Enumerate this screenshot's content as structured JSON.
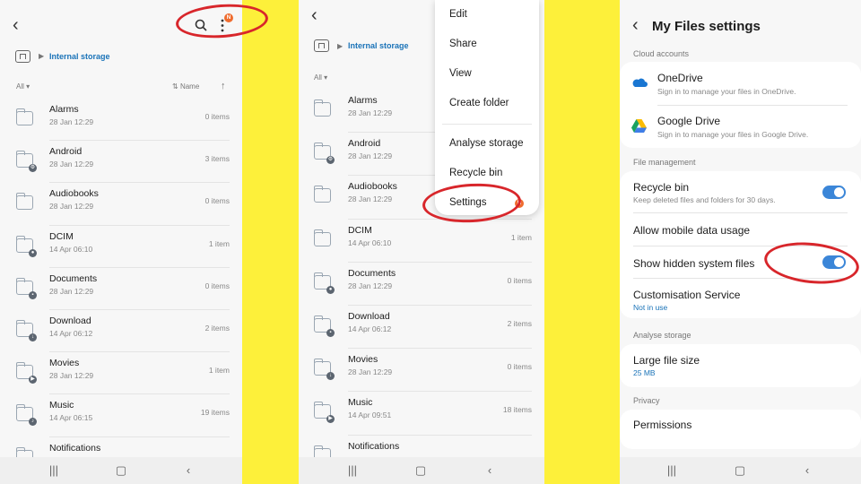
{
  "colors": {
    "accent": "#1a73b8",
    "annotation": "#d8262b",
    "background": "#fdf03a",
    "badge": "#ef6c2f",
    "toggle": "#3b86d8"
  },
  "panel1": {
    "breadcrumb": "Internal storage",
    "filter": "All",
    "sort": "Name",
    "notification_badge": "N",
    "files": [
      {
        "name": "Alarms",
        "date": "28 Jan 12:29",
        "count": "0 items",
        "badge": ""
      },
      {
        "name": "Android",
        "date": "28 Jan 12:29",
        "count": "3 items",
        "badge": "gear"
      },
      {
        "name": "Audiobooks",
        "date": "28 Jan 12:29",
        "count": "0 items",
        "badge": ""
      },
      {
        "name": "DCIM",
        "date": "14 Apr 06:10",
        "count": "1 item",
        "badge": "camera"
      },
      {
        "name": "Documents",
        "date": "28 Jan 12:29",
        "count": "0 items",
        "badge": "doc"
      },
      {
        "name": "Download",
        "date": "14 Apr 06:12",
        "count": "2 items",
        "badge": "download"
      },
      {
        "name": "Movies",
        "date": "28 Jan 12:29",
        "count": "1 item",
        "badge": "play"
      },
      {
        "name": "Music",
        "date": "14 Apr 06:15",
        "count": "19 items",
        "badge": "music"
      },
      {
        "name": "Notifications",
        "date": "",
        "count": "",
        "badge": ""
      }
    ]
  },
  "panel2": {
    "breadcrumb": "Internal storage",
    "filter": "All",
    "files": [
      {
        "name": "Alarms",
        "date": "28 Jan 12:29",
        "count": ""
      },
      {
        "name": "Android",
        "date": "28 Jan 12:29",
        "count": ""
      },
      {
        "name": "Audiobooks",
        "date": "28 Jan 12:29",
        "count": ""
      },
      {
        "name": "DCIM",
        "date": "14 Apr 06:10",
        "count": "1 item"
      },
      {
        "name": "Documents",
        "date": "28 Jan 12:29",
        "count": "0 items"
      },
      {
        "name": "Download",
        "date": "14 Apr 06:12",
        "count": "2 items"
      },
      {
        "name": "Movies",
        "date": "28 Jan 12:29",
        "count": "0 items"
      },
      {
        "name": "Music",
        "date": "14 Apr 09:51",
        "count": "18 items"
      },
      {
        "name": "Notifications",
        "date": "",
        "count": ""
      }
    ],
    "menu": [
      "Edit",
      "Share",
      "View",
      "Create folder",
      "Analyse storage",
      "Recycle bin",
      "Settings"
    ],
    "menu_badge": "N"
  },
  "panel3": {
    "title": "My Files settings",
    "sections": {
      "cloud": "Cloud accounts",
      "file_mgmt": "File management",
      "analyse": "Analyse storage",
      "privacy": "Privacy"
    },
    "onedrive": {
      "title": "OneDrive",
      "desc": "Sign in to manage your files in OneDrive."
    },
    "gdrive": {
      "title": "Google Drive",
      "desc": "Sign in to manage your files in Google Drive."
    },
    "recycle": {
      "title": "Recycle bin",
      "desc": "Keep deleted files and folders for 30 days.",
      "on": true
    },
    "mobile_data": {
      "title": "Allow mobile data usage"
    },
    "hidden": {
      "title": "Show hidden system files",
      "on": true
    },
    "custom": {
      "title": "Customisation Service",
      "value": "Not in use"
    },
    "large": {
      "title": "Large file size",
      "value": "25 MB"
    },
    "permissions": {
      "title": "Permissions"
    }
  }
}
